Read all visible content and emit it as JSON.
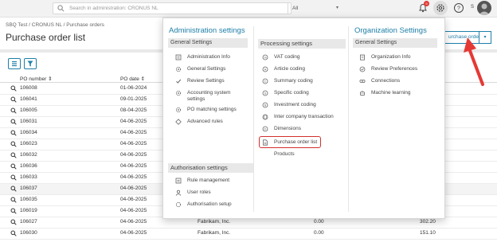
{
  "topbar": {
    "search_placeholder": "Search in administration: CRONUS NL",
    "scope": "All",
    "notification_count": "9",
    "user_initial": "S"
  },
  "page": {
    "breadcrumb": "SBQ Test  /  CRONUS NL  /  Purchase orders",
    "title": "Purchase order list",
    "header_button": "urchase order"
  },
  "table": {
    "columns": [
      "PO number",
      "PO date"
    ],
    "rows": [
      {
        "po": "106008",
        "date": "01-06-2024",
        "vendor": "",
        "a": "",
        "b": ""
      },
      {
        "po": "106041",
        "date": "09-01-2025",
        "vendor": "",
        "a": "",
        "b": ""
      },
      {
        "po": "106005",
        "date": "08-04-2025",
        "vendor": "",
        "a": "",
        "b": ""
      },
      {
        "po": "106031",
        "date": "04-06-2025",
        "vendor": "",
        "a": "",
        "b": ""
      },
      {
        "po": "106034",
        "date": "04-06-2025",
        "vendor": "",
        "a": "",
        "b": ""
      },
      {
        "po": "106023",
        "date": "04-06-2025",
        "vendor": "",
        "a": "",
        "b": ""
      },
      {
        "po": "106032",
        "date": "04-06-2025",
        "vendor": "",
        "a": "",
        "b": ""
      },
      {
        "po": "106036",
        "date": "04-06-2025",
        "vendor": "",
        "a": "",
        "b": ""
      },
      {
        "po": "106033",
        "date": "04-06-2025",
        "vendor": "",
        "a": "",
        "b": ""
      },
      {
        "po": "106037",
        "date": "04-06-2025",
        "vendor": "",
        "a": "",
        "b": ""
      },
      {
        "po": "106035",
        "date": "04-06-2025",
        "vendor": "",
        "a": "",
        "b": ""
      },
      {
        "po": "106019",
        "date": "04-06-2025",
        "vendor": "Fabrikam, Inc.",
        "a": "0.00",
        "b": ""
      },
      {
        "po": "106027",
        "date": "04-06-2025",
        "vendor": "Fabrikam, Inc.",
        "a": "0.00",
        "b": "302.20"
      },
      {
        "po": "106030",
        "date": "04-06-2025",
        "vendor": "Fabrikam, Inc.",
        "a": "0.00",
        "b": "151.10"
      }
    ]
  },
  "menu": {
    "col1_title": "Administration settings",
    "col1_section1": "General Settings",
    "col1_items": [
      "Administration Info",
      "General Settings",
      "Review Settings",
      "Accounting system",
      "settings",
      "PO matching settings",
      "Advanced rules"
    ],
    "col1_section2": "Authorisation settings",
    "col1_auth_items": [
      "Rule management",
      "User roles",
      "Authorisation setup"
    ],
    "col2_title": "Processing settings",
    "col2_items": [
      "VAT coding",
      "Article coding",
      "Summary coding",
      "Specific coding",
      "Investment coding",
      "Inter company transaction",
      "Dimensions",
      "Purchase order list",
      "Products"
    ],
    "col3_title": "Organization Settings",
    "col3_section": "General Settings",
    "col3_items": [
      "Organization Info",
      "Review Preferences",
      "Connections",
      "Machine learning"
    ]
  },
  "colors": {
    "accent": "#1e7fa8",
    "highlight": "#d32f2f",
    "arrow": "#e53935"
  }
}
